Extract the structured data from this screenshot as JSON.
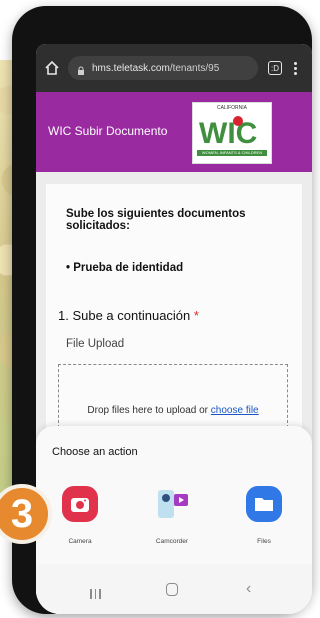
{
  "browser": {
    "url_host": "hms.teletask.com",
    "url_path": "/tenants/95",
    "tabs_count": ":D"
  },
  "header": {
    "title": "WIC Subir Documento",
    "logo_small_text": "CALIFORNIA",
    "logo_text": "WIC",
    "logo_tagline": "WOMEN, INFANTS & CHILDREN"
  },
  "form": {
    "intro": "Sube los siguientes documentos solicitados:",
    "bullet": "• Prueba de identidad",
    "section_title": "1. Sube a continuación",
    "required_mark": "*",
    "upload_label": "File Upload",
    "drop_text": "Drop files here to upload or",
    "drop_link": "choose file"
  },
  "sheet": {
    "title": "Choose an action",
    "actions": [
      {
        "label": "Camera",
        "icon": "camera-icon"
      },
      {
        "label": "Camcorder",
        "icon": "camcorder-icon"
      },
      {
        "label": "Files",
        "icon": "folder-icon"
      }
    ]
  },
  "step_badge": "3",
  "colors": {
    "header": "#9a2aa0",
    "camera": "#e0324a",
    "files": "#2f78e6",
    "badge": "#e6892f",
    "link": "#1a56c9"
  }
}
